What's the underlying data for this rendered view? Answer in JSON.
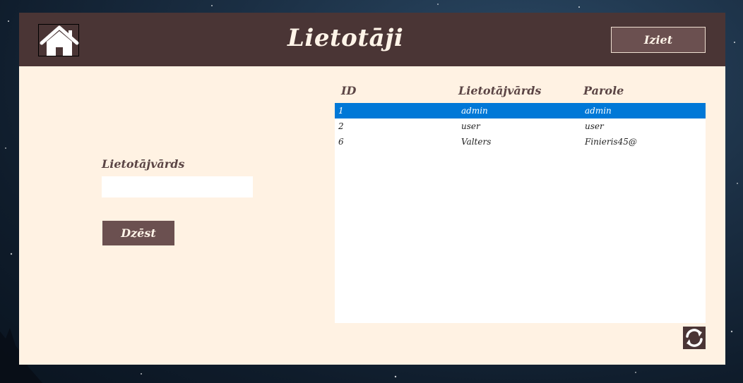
{
  "header": {
    "title": "Lietotāji",
    "logout_label": "Iziet",
    "home_icon": "home-icon"
  },
  "form": {
    "username_label": "Lietotājvārds",
    "username_value": "",
    "delete_label": "Dzēst"
  },
  "table": {
    "columns": [
      "ID",
      "Lietotājvārds",
      "Parole"
    ],
    "rows": [
      {
        "id": "1",
        "username": "admin",
        "password": "admin",
        "selected": true
      },
      {
        "id": "2",
        "username": "user",
        "password": "user",
        "selected": false
      },
      {
        "id": "6",
        "username": "Valters",
        "password": "Finieris45@",
        "selected": false
      }
    ]
  },
  "footer": {
    "refresh_icon": "refresh-icon"
  },
  "colors": {
    "header_bg": "#4a3535",
    "panel_bg": "#fff2e3",
    "button_bg": "#6b5050",
    "selection": "#0078d7"
  }
}
